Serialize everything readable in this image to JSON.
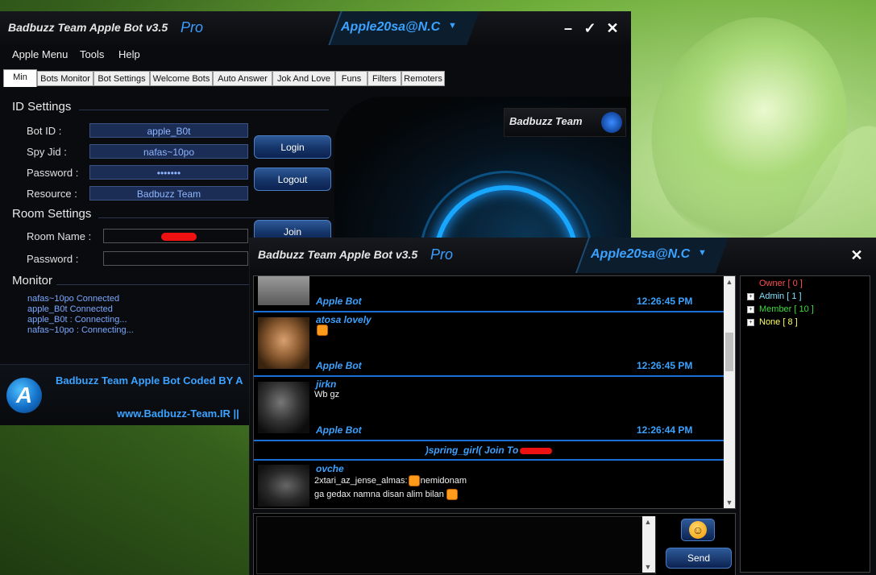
{
  "window1": {
    "title": "Badbuzz Team Apple Bot  v3.5",
    "pro": "Pro",
    "account": "Apple20sa@N.C",
    "menu": [
      "Apple Menu",
      "Tools",
      "Help"
    ],
    "tabs": [
      "Min",
      "Bots Monitor",
      "Bot Settings",
      "Welcome Bots",
      "Auto Answer",
      "Jok And Love",
      "Funs",
      "Filters",
      "Remoters"
    ],
    "id_settings": {
      "title": "ID Settings",
      "bot_id_label": "Bot ID :",
      "bot_id_value": "apple_B0t",
      "spy_jid_label": "Spy Jid :",
      "spy_jid_value": "nafas~10po",
      "password_label": "Password :",
      "password_value": "•••••••",
      "resource_label": "Resource :",
      "resource_value": "Badbuzz Team"
    },
    "room_settings": {
      "title": "Room Settings",
      "room_name_label": "Room Name :",
      "password_label": "Password :"
    },
    "buttons": {
      "login": "Login",
      "logout": "Logout",
      "join": "Join"
    },
    "monitor": {
      "title": "Monitor",
      "lines": [
        "nafas~10po Connected",
        "apple_B0t Connected",
        "apple_B0t : Connecting...",
        "nafas~10po : Connecting..."
      ]
    },
    "brand": "Badbuzz Team",
    "footer": {
      "line1": "Badbuzz Team Apple Bot Coded BY A",
      "line2": "www.Badbuzz-Team.IR  ||",
      "logo": "A"
    }
  },
  "window2": {
    "title": "Badbuzz Team Apple Bot  v3.5",
    "pro": "Pro",
    "account": "Apple20sa@N.C",
    "messages": [
      {
        "name": "",
        "text": "",
        "footer": "Apple Bot",
        "time": "12:26:45 PM"
      },
      {
        "name": "atosa  lovely",
        "text": "",
        "footer": "Apple Bot",
        "time": "12:26:45 PM"
      },
      {
        "name": "jirkn",
        "text": "Wb gz",
        "footer": "Apple Bot",
        "time": "12:26:44 PM"
      }
    ],
    "join_line": ")spring_girl( Join To",
    "last_message": {
      "name": "ovche",
      "line1a": "2xtari_az_jense_almas:",
      "line1b": "nemidonam",
      "line2": " ga gedax namna disan alim bilan"
    },
    "send": "Send",
    "groups": [
      {
        "label": "Owner [ 0 ]",
        "color": "#ff5050"
      },
      {
        "label": "Admin [ 1 ]",
        "color": "#7fe3ff"
      },
      {
        "label": "Member [ 10 ]",
        "color": "#3bdc3b"
      },
      {
        "label": "None [ 8 ]",
        "color": "#ffff66"
      }
    ]
  }
}
